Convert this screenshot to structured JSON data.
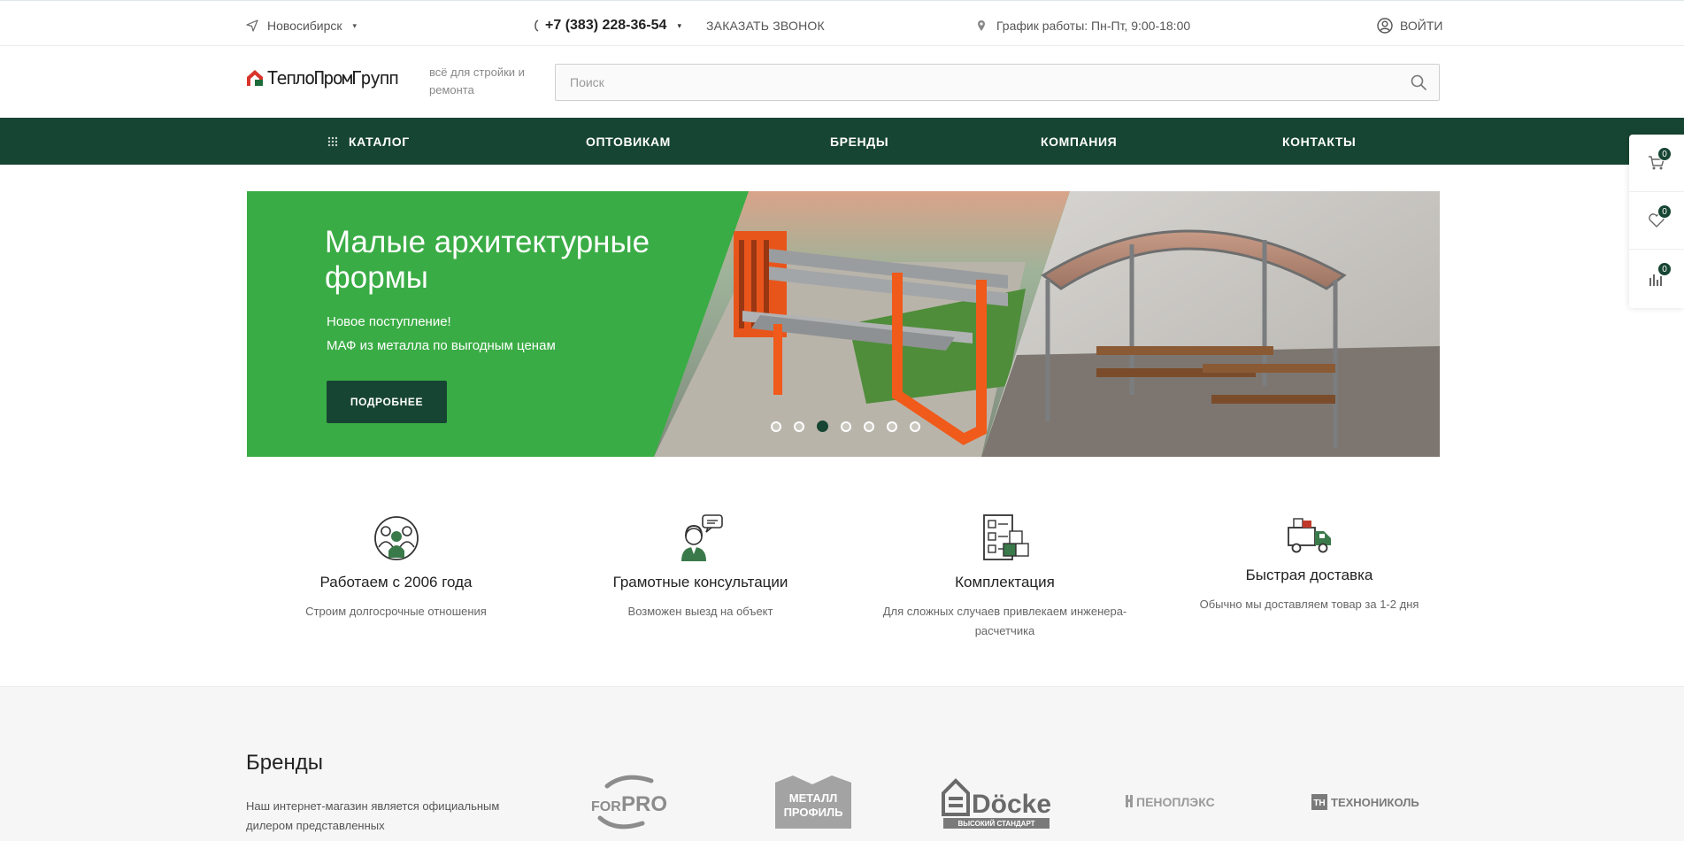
{
  "topbar": {
    "city": "Новосибирск",
    "phone": "+7 (383) 228-36-54",
    "callback": "ЗАКАЗАТЬ ЗВОНОК",
    "hours": "График работы: Пн-Пт, 9:00-18:00",
    "login": "ВОЙТИ"
  },
  "header": {
    "logo_text": "ТеплоПромГрупп",
    "slogan": "всё для стройки и ремонта",
    "search_placeholder": "Поиск"
  },
  "nav": {
    "catalog": "КАТАЛОГ",
    "wholesale": "ОПТОВИКАМ",
    "brands": "БРЕНДЫ",
    "company": "КОМПАНИЯ",
    "contacts": "КОНТАКТЫ"
  },
  "banner": {
    "title": "Малые архитектурные формы",
    "line1": "Новое поступление!",
    "line2": "МАФ из металла по выгодным ценам",
    "button": "ПОДРОБНЕЕ",
    "slides_total": 7,
    "active_slide": 3
  },
  "features": [
    {
      "title": "Работаем с 2006 года",
      "desc": "Строим долгосрочные отношения",
      "icon": "team-icon"
    },
    {
      "title": "Грамотные консультации",
      "desc": "Возможен выезд на объект",
      "icon": "consultant-icon"
    },
    {
      "title": "Комплектация",
      "desc": "Для сложных случаев привлекаем инженера-расчетчика",
      "icon": "checklist-icon"
    },
    {
      "title": "Быстрая доставка",
      "desc": "Обычно мы доставляем товар за 1-2 дня",
      "icon": "truck-icon"
    }
  ],
  "brands": {
    "title": "Бренды",
    "text": "Наш интернет-магазин является официальным дилером представленных",
    "logos": {
      "forpro_a": "FOR",
      "forpro_b": "PRO",
      "metall_a": "МЕТАЛЛ",
      "metall_b": "ПРОФИЛЬ",
      "docke": "Döcke",
      "docke_sub": "ВЫСОКИЙ СТАНДАРТ",
      "penoplex": "ПЕНОПЛЭКС",
      "tn": "ТЕХНОНИКОЛЬ"
    }
  },
  "side": {
    "cart_count": "0",
    "fav_count": "0",
    "compare_count": "0"
  },
  "colors": {
    "accent": "#174533",
    "banner_green": "#3aac45",
    "link": "#2e7d6b"
  }
}
